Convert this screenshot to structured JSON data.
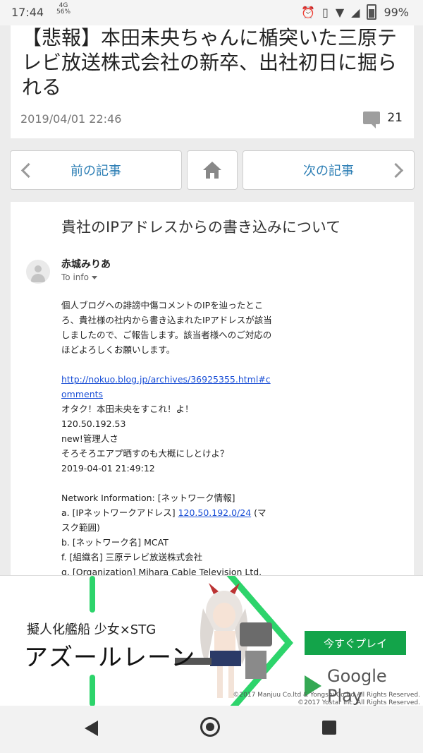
{
  "status": {
    "time": "17:44",
    "data_label": "4G",
    "data_rate": "56%",
    "battery": "99%"
  },
  "article": {
    "title": "【悲報】本田未央ちゃんに楯突いた三原テレビ放送株式会社の新卒、出社初日に掘られる",
    "date": "2019/04/01 22:46",
    "comment_count": "21"
  },
  "nav": {
    "prev_label": "前の記事",
    "next_label": "次の記事"
  },
  "email": {
    "subject": "貴社のIPアドレスからの書き込みについて",
    "sender": "赤城みりあ",
    "to": "To info",
    "paragraph": "個人ブログへの誹謗中傷コメントのIPを辿ったところ、貴社様の社内から書き込まれたIPアドレスが該当しましたので、ご報告します。該当者様へのご対応のほどよろしくお願いします。",
    "link": "http://nokuo.blog.jp/archives/36925355.html#comments",
    "lines": [
      "オタク！本田未央をすこれ！よ！",
      "120.50.192.53",
      "new!管理人さ",
      "そろそろエアプ晒すのも大概にしとけよ？",
      "2019-04-01 21:49:12"
    ],
    "netinfo_header": "Network Information: [ネットワーク情報]",
    "net_a_prefix": "a. [IPネットワークアドレス] ",
    "net_a_link": "120.50.192.0/24",
    "net_a_suffix": " (マスク範囲)",
    "net_b": "b. [ネットワーク名] MCAT",
    "net_f": "f. [組織名] 三原テレビ放送株式会社",
    "net_g": "g. [Organization] Mihara Cable Television Ltd."
  },
  "ad": {
    "tagline": "擬人化艦船 少女×STG",
    "game_title": "アズールレーン",
    "cta": "今すぐプレイ",
    "store": "Google Play",
    "copyright_1": "©2017 Manjuu Co.ltd & Yongshi Co.ltd All Rights Reserved.",
    "copyright_2": "©2017 Yostar Inc. All Rights Reserved."
  },
  "colors": {
    "link_blue": "#2e7fb5",
    "ad_green": "#13a44a",
    "accent_line": "#2dd46b"
  }
}
